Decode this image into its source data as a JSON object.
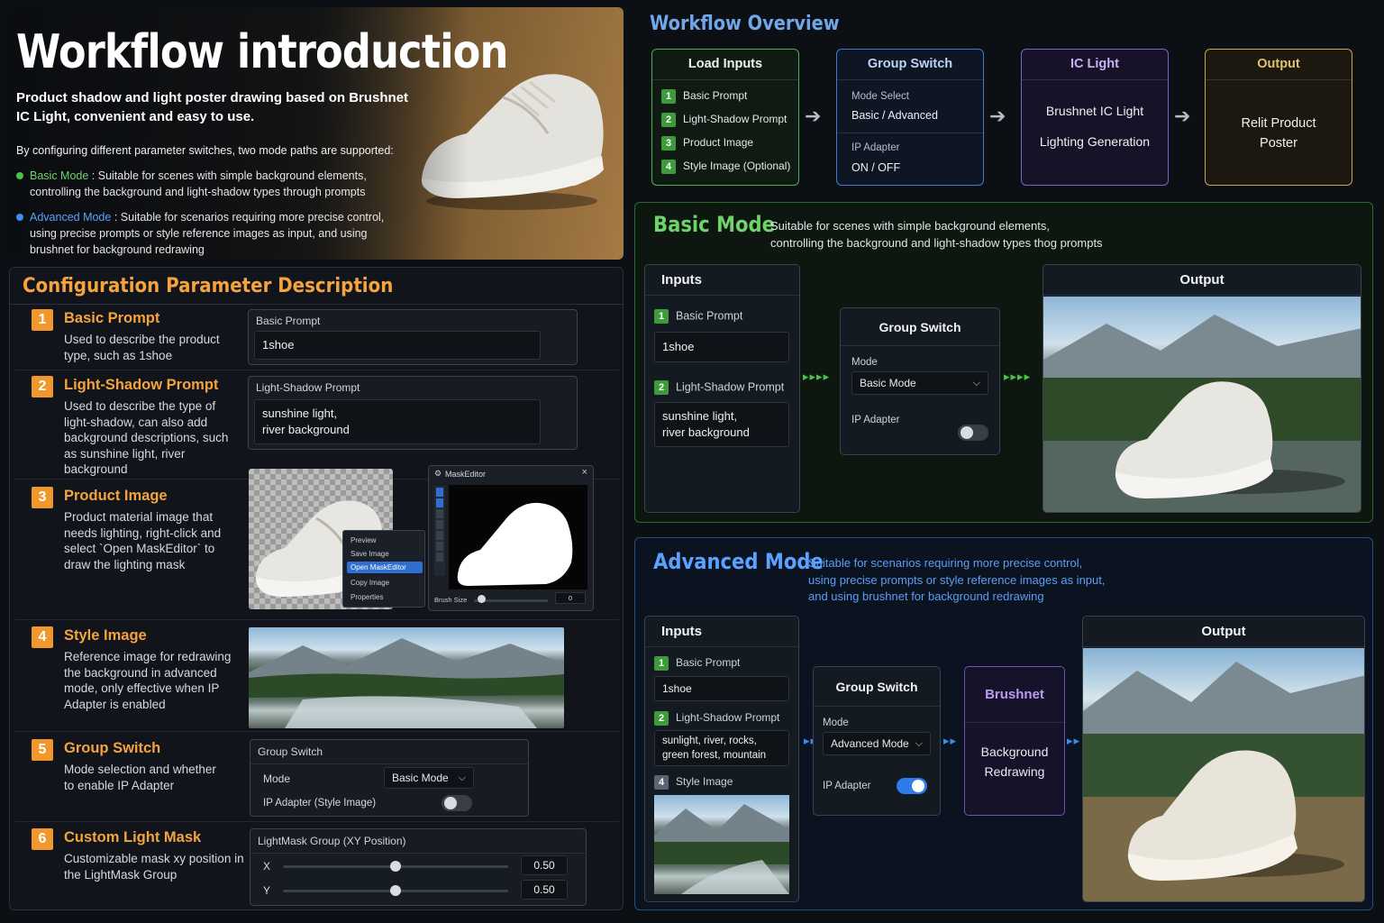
{
  "hero": {
    "title": "Workflow introduction",
    "subtitle": "Product shadow and light poster drawing based on Brushnet IC Light, convenient and easy to use.",
    "modes_intro": "By configuring different parameter switches, two mode paths are supported:",
    "basic_mode_name": "Basic Mode",
    "basic_mode_desc": ": Suitable for scenes with simple background elements, controlling the background and light-shadow types through prompts",
    "advanced_mode_name": "Advanced Mode",
    "advanced_mode_desc": ": Suitable for scenarios requiring more precise control, using precise prompts or style reference images as input, and using brushnet for background redrawing"
  },
  "config": {
    "title": "Configuration Parameter Description",
    "params": [
      {
        "num": "1",
        "title": "Basic Prompt",
        "desc": "Used to describe the product type, such as 1shoe"
      },
      {
        "num": "2",
        "title": "Light-Shadow Prompt",
        "desc": "Used to describe the type of light-shadow, can also add background descriptions, such as sunshine light, river background"
      },
      {
        "num": "3",
        "title": "Product Image",
        "desc": "Product material image that needs lighting, right-click and select `Open MaskEditor` to draw the lighting mask"
      },
      {
        "num": "4",
        "title": "Style Image",
        "desc": "Reference image for redrawing the background in advanced mode, only effective when IP Adapter is enabled"
      },
      {
        "num": "5",
        "title": "Group Switch",
        "desc": "Mode selection and whether to enable IP Adapter"
      },
      {
        "num": "6",
        "title": "Custom Light Mask",
        "desc": "Customizable mask xy position in the LightMask Group"
      }
    ],
    "basic_prompt_box": {
      "label": "Basic Prompt",
      "value": "1shoe"
    },
    "light_shadow_box": {
      "label": "Light-Shadow Prompt",
      "value_line1": "sunshine light,",
      "value_line2": "river background"
    },
    "context_menu": [
      "Preview",
      "Save Image",
      "Open MaskEditor",
      "Copy Image",
      "Properties"
    ],
    "mask_editor": {
      "title": "MaskEditor",
      "close": "×",
      "brush_label": "Brush Size",
      "brush_value": "0",
      "brush_level": 0.1
    },
    "group_switch_box": {
      "label": "Group Switch",
      "mode_label": "Mode",
      "mode_value": "Basic Mode",
      "ip_label": "IP Adapter (Style Image)",
      "ip_on": false
    },
    "lightmask_box": {
      "label": "LightMask Group (XY Position)",
      "x_label": "X",
      "x_value": "0.50",
      "y_label": "Y",
      "y_value": "0.50"
    }
  },
  "workflow": {
    "title": "Workflow Overview",
    "load_inputs": {
      "title": "Load Inputs",
      "items": [
        {
          "num": "1",
          "label": "Basic Prompt"
        },
        {
          "num": "2",
          "label": "Light-Shadow Prompt"
        },
        {
          "num": "3",
          "label": "Product Image"
        },
        {
          "num": "4",
          "label": "Style Image (Optional)"
        }
      ]
    },
    "group_switch": {
      "title": "Group Switch",
      "mode_label": "Mode Select",
      "mode_value": "Basic / Advanced",
      "ip_label": "IP Adapter",
      "ip_value": "ON / OFF"
    },
    "ic_light": {
      "title": "IC Light",
      "line1": "Brushnet IC Light",
      "line2": "Lighting Generation"
    },
    "output": {
      "title": "Output",
      "line1": "Relit Product",
      "line2": "Poster"
    },
    "arrow": "➔"
  },
  "basic_mode": {
    "title": "Basic Mode",
    "desc_line1": "Suitable for scenes with simple background elements,",
    "desc_line2": "controlling the background and light-shadow types thog prompts",
    "inputs_title": "Inputs",
    "basic_prompt_label": "Basic Prompt",
    "basic_prompt_value": "1shoe",
    "light_shadow_label": "Light-Shadow Prompt",
    "light_shadow_line1": "sunshine light,",
    "light_shadow_line2": "river background",
    "group_switch_title": "Group Switch",
    "mode_label": "Mode",
    "mode_value": "Basic Mode",
    "ip_label": "IP Adapter",
    "ip_on": false,
    "output_title": "Output",
    "arrow": "▸▸▸▸"
  },
  "advanced_mode": {
    "title": "Advanced Mode",
    "desc_line1": "Suitable for scenarios requiring more precise control,",
    "desc_line2": "using precise prompts or style reference images as input,",
    "desc_line3": "and using brushnet for background redrawing",
    "inputs_title": "Inputs",
    "basic_prompt_label": "Basic Prompt",
    "basic_prompt_value": "1shoe",
    "light_shadow_label": "Light-Shadow Prompt",
    "light_shadow_line1": "sunlight, river, rocks,",
    "light_shadow_line2": "green forest, mountain",
    "style_image_label": "Style Image",
    "group_switch_title": "Group Switch",
    "mode_label": "Mode",
    "mode_value": "Advanced Mode",
    "ip_label": "IP Adapter",
    "ip_on": true,
    "brushnet_title": "Brushnet",
    "brushnet_line1": "Background",
    "brushnet_line2": "Redrawing",
    "output_title": "Output",
    "arrow": "▸▸"
  },
  "colors": {
    "accent_orange": "#f5a33c",
    "basic_green": "#6fd26a",
    "advanced_blue": "#5aa2ff",
    "ic_purple": "#9a7ee0",
    "output_gold": "#d9b45a"
  }
}
